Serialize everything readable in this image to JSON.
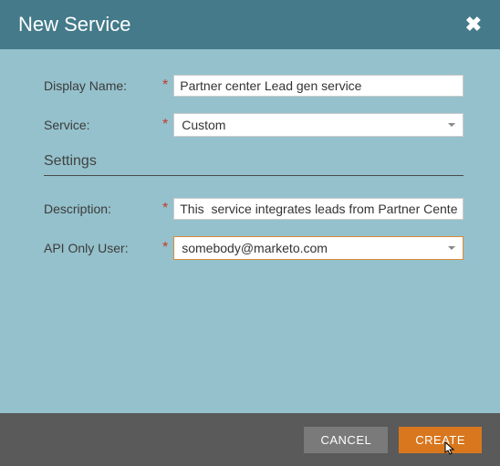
{
  "header": {
    "title": "New Service"
  },
  "form": {
    "displayName": {
      "label": "Display Name:",
      "value": "Partner center Lead gen service"
    },
    "service": {
      "label": "Service:",
      "value": "Custom"
    },
    "settingsTitle": "Settings",
    "description": {
      "label": "Description:",
      "value": "This  service integrates leads from Partner Center"
    },
    "apiOnlyUser": {
      "label": "API Only User:",
      "value": "somebody@marketo.com"
    }
  },
  "footer": {
    "cancel": "CANCEL",
    "create": "CREATE"
  }
}
